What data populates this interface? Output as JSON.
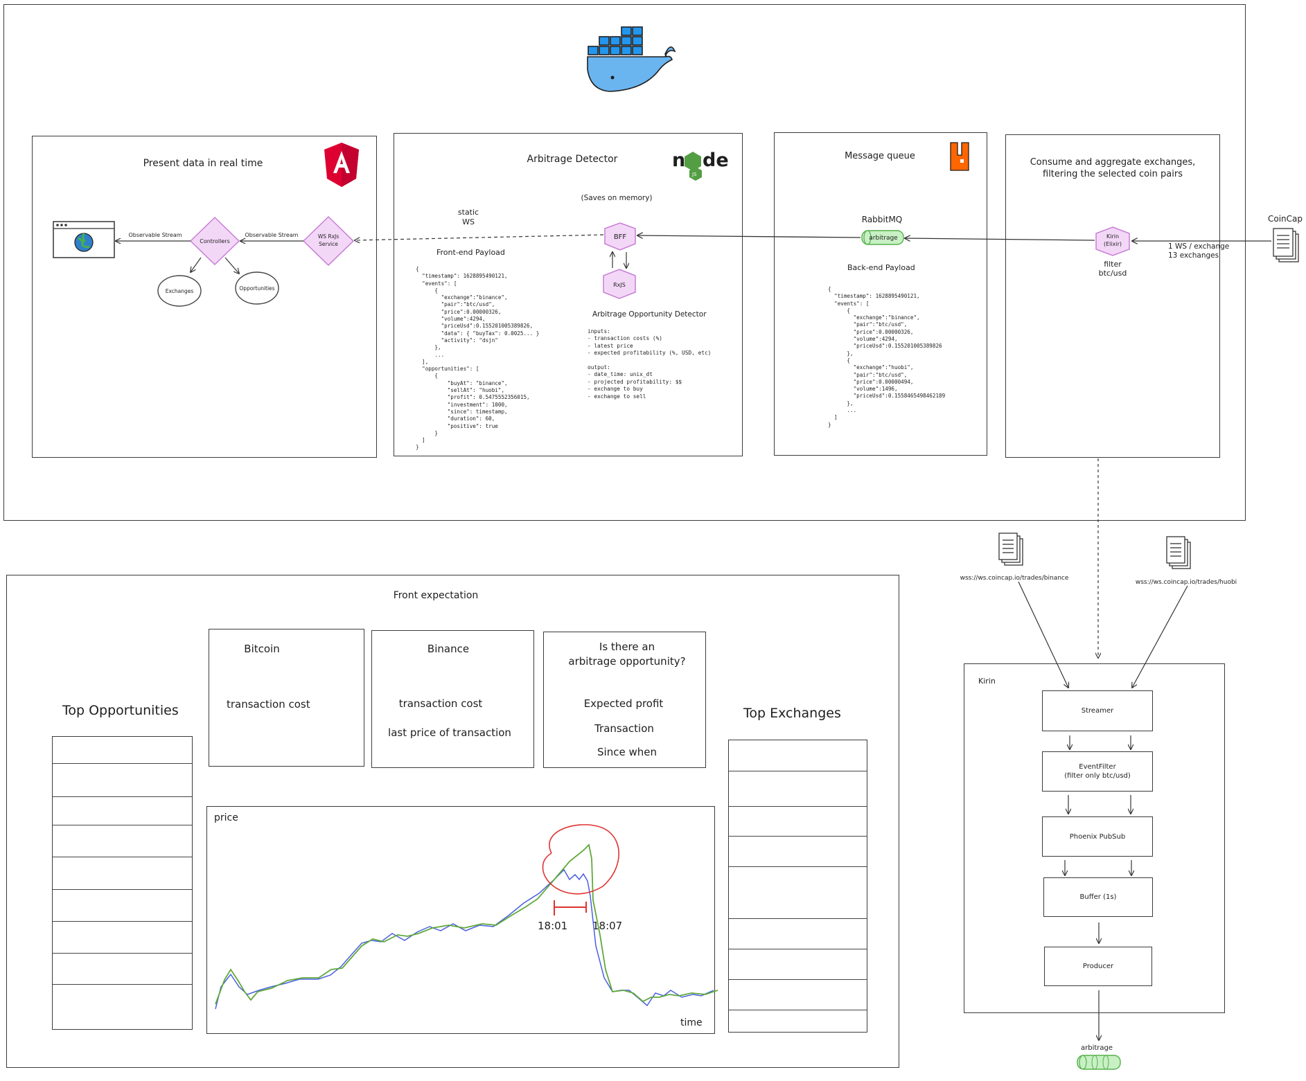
{
  "main_panels": {
    "angular": {
      "title": "Present data in real time"
    },
    "detector": {
      "title": "Arbitrage Detector",
      "saves_note": "(Saves on memory)",
      "static_ws": "static\nWS",
      "frontend_payload": "Front-end Payload",
      "subtitle": "Arbitrage Opportunity Detector",
      "inputs_lines": [
        "inputs:",
        "- transaction costs (%)",
        "- latest price",
        "- expected profitability (%, USD, etc)"
      ],
      "output_lines": [
        "output:",
        "- date_time: unix_dt",
        "- projected profitability: $$",
        "- exchange to buy",
        "- exchange to sell"
      ]
    },
    "queue": {
      "title": "Message queue",
      "rabbit_label": "RabbitMQ",
      "queue_name": "arbitrage",
      "backend_payload": "Back-end Payload"
    },
    "consumer": {
      "title": "Consume and aggregate exchanges,\nfiltering the selected coin pairs",
      "kirin_label": "Kirin\n(Elixir)",
      "filter_label": "filter\nbtc/usd"
    }
  },
  "nodes": {
    "controllers": "Controllers",
    "ws_service": "WS RxJs\nService",
    "exchanges": "Exchanges",
    "opportunities": "Opportunities",
    "bff": "BFF",
    "rxjs": "RxJS"
  },
  "edges": {
    "observable_stream_1": "Observable Stream",
    "observable_stream_2": "Observable Stream"
  },
  "coincap": {
    "label": "CoinCap",
    "note": "1 WS / exchange\n13 exchanges"
  },
  "frontend_payload_json": "{\n  \"timestamp\": 1628895490121,\n  \"events\": [\n      {\n        \"exchange\":\"binance\",\n        \"pair\":\"btc/usd\",\n        \"price\":0.00000326,\n        \"volume\":4294,\n        \"priceUsd\":0.155201005389826,\n        \"data\": { \"buyTax\": 0.0025... }\n        \"activity\": \"dsjn\"\n      },\n      ...\n  ],\n  \"opportunities\": [\n      {\n          \"buyAt\": \"binance\",\n          \"sellAt\": \"huobi\",\n          \"profit\": 0.5475552356015,\n          \"investment\": 1000,\n          \"since\": timestamp,\n          \"duration\": 60,\n          \"positive\": true\n      }\n  ]\n}",
  "backend_payload_json": "{\n  \"timestamp\": 1628895490121,\n  \"events\": [\n      {\n        \"exchange\":\"binance\",\n        \"pair\":\"btc/usd\",\n        \"price\":0.00000326,\n        \"volume\":4294,\n        \"priceUsd\":0.155201005389826\n      },\n      {\n        \"exchange\":\"huobi\",\n        \"pair\":\"btc/usd\",\n        \"price\":0.00000494,\n        \"volume\":1496,\n        \"priceUsd\":0.1558465498462189\n      },\n      ...\n  ]\n}",
  "front_expectation": {
    "title": "Front expectation",
    "top_opportunities": "Top Opportunities",
    "top_exchanges": "Top Exchanges",
    "bitcoin_card": {
      "title": "Bitcoin",
      "lines": [
        "transaction cost"
      ]
    },
    "binance_card": {
      "title": "Binance",
      "lines": [
        "transaction cost",
        "last price of transaction"
      ]
    },
    "arbitrage_card": {
      "title": "Is there an\narbitrage opportunity?",
      "lines": [
        "Expected profit",
        "Transaction",
        "Since when"
      ]
    },
    "chart": {
      "ylabel": "price",
      "xlabel": "time",
      "marker_start": "18:01",
      "marker_end": "18:07"
    }
  },
  "kirin_detail": {
    "title": "Kirin",
    "source_binance": "wss://ws.coincap.io/trades/binance",
    "source_huobi": "wss://ws.coincap.io/trades/huobi",
    "stages": [
      "Streamer",
      "EventFilter\n(filter only btc/usd)",
      "Phoenix PubSub",
      "Buffer (1s)",
      "Producer"
    ],
    "output_queue": "arbitrage"
  },
  "colors": {
    "angular_red": "#dd0031",
    "node_green": "#539e43",
    "rabbit_orange": "#ff6600",
    "diamond_fill": "#f3d7f7",
    "diamond_stroke": "#c77ed6",
    "queue_fill": "#c8f0c4",
    "queue_stroke": "#55b04c",
    "docker_blue": "#2496ed",
    "series_blue": "#4a5fe0",
    "series_green": "#5fa83a",
    "annotation_red": "#e03131"
  }
}
